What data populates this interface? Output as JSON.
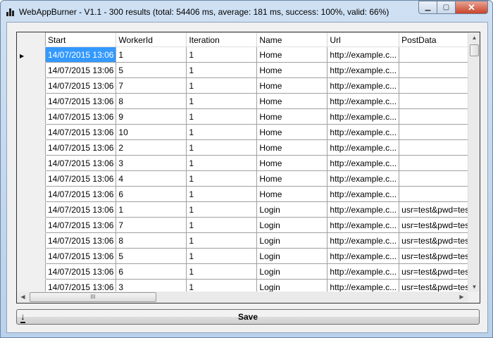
{
  "window": {
    "title": "WebAppBurner - V1.1 - 300 results (total: 54406 ms, average: 181 ms, success: 100%, valid: 66%)"
  },
  "grid": {
    "columns": [
      "Start",
      "WorkerId",
      "Iteration",
      "Name",
      "Url",
      "PostData"
    ],
    "rows": [
      [
        "14/07/2015 13:06",
        "1",
        "1",
        "Home",
        "http://example.c...",
        ""
      ],
      [
        "14/07/2015 13:06",
        "5",
        "1",
        "Home",
        "http://example.c...",
        ""
      ],
      [
        "14/07/2015 13:06",
        "7",
        "1",
        "Home",
        "http://example.c...",
        ""
      ],
      [
        "14/07/2015 13:06",
        "8",
        "1",
        "Home",
        "http://example.c...",
        ""
      ],
      [
        "14/07/2015 13:06",
        "9",
        "1",
        "Home",
        "http://example.c...",
        ""
      ],
      [
        "14/07/2015 13:06",
        "10",
        "1",
        "Home",
        "http://example.c...",
        ""
      ],
      [
        "14/07/2015 13:06",
        "2",
        "1",
        "Home",
        "http://example.c...",
        ""
      ],
      [
        "14/07/2015 13:06",
        "3",
        "1",
        "Home",
        "http://example.c...",
        ""
      ],
      [
        "14/07/2015 13:06",
        "4",
        "1",
        "Home",
        "http://example.c...",
        ""
      ],
      [
        "14/07/2015 13:06",
        "6",
        "1",
        "Home",
        "http://example.c...",
        ""
      ],
      [
        "14/07/2015 13:06",
        "1",
        "1",
        "Login",
        "http://example.c...",
        "usr=test&pwd=test"
      ],
      [
        "14/07/2015 13:06",
        "7",
        "1",
        "Login",
        "http://example.c...",
        "usr=test&pwd=test"
      ],
      [
        "14/07/2015 13:06",
        "8",
        "1",
        "Login",
        "http://example.c...",
        "usr=test&pwd=test"
      ],
      [
        "14/07/2015 13:06",
        "5",
        "1",
        "Login",
        "http://example.c...",
        "usr=test&pwd=test"
      ],
      [
        "14/07/2015 13:06",
        "6",
        "1",
        "Login",
        "http://example.c...",
        "usr=test&pwd=test"
      ],
      [
        "14/07/2015 13:06",
        "3",
        "1",
        "Login",
        "http://example.c...",
        "usr=test&pwd=test"
      ]
    ]
  },
  "save_label": "Save"
}
